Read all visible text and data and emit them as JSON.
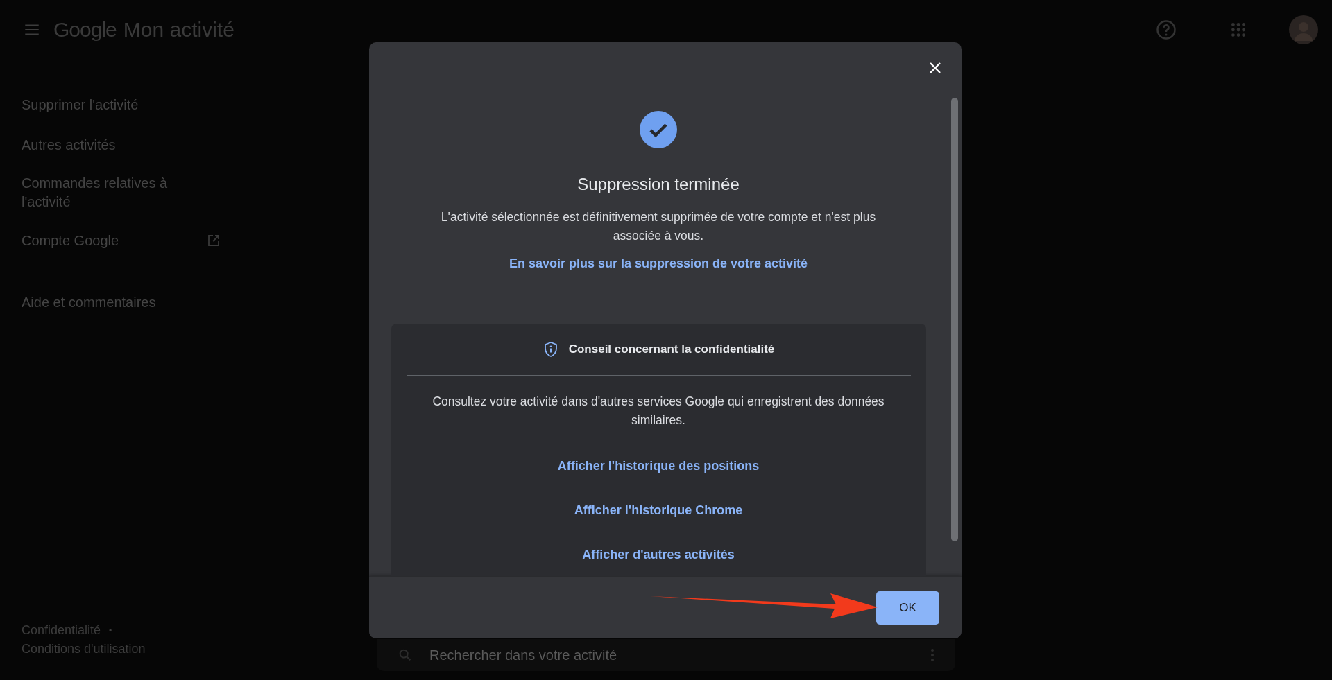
{
  "header": {
    "logo": "Google",
    "title": "Mon activité"
  },
  "sidebar": {
    "sections": [
      {
        "items": [
          {
            "label": "Supprimer l'activité",
            "external": false
          },
          {
            "label": "Autres activités",
            "external": false
          },
          {
            "label": "Commandes relatives à l'activité",
            "external": false
          },
          {
            "label": "Compte Google",
            "external": true
          }
        ]
      },
      {
        "items": [
          {
            "label": "Aide et commentaires",
            "external": false
          }
        ]
      }
    ]
  },
  "footer": {
    "links": [
      "Confidentialité",
      "Conditions d'utilisation"
    ],
    "separator": "•"
  },
  "search": {
    "placeholder": "Rechercher dans votre activité"
  },
  "dialog": {
    "title": "Suppression terminée",
    "message": "L'activité sélectionnée est définitivement supprimée de votre compte et n'est plus associée à vous.",
    "link": "En savoir plus sur la suppression de votre activité",
    "tip": {
      "title": "Conseil concernant la confidentialité",
      "text": "Consultez votre activité dans d'autres services Google qui enregistrent des données similaires.",
      "links": [
        "Afficher l'historique des positions",
        "Afficher l'historique Chrome",
        "Afficher d'autres activités"
      ]
    },
    "buttons": [
      "OK"
    ]
  }
}
